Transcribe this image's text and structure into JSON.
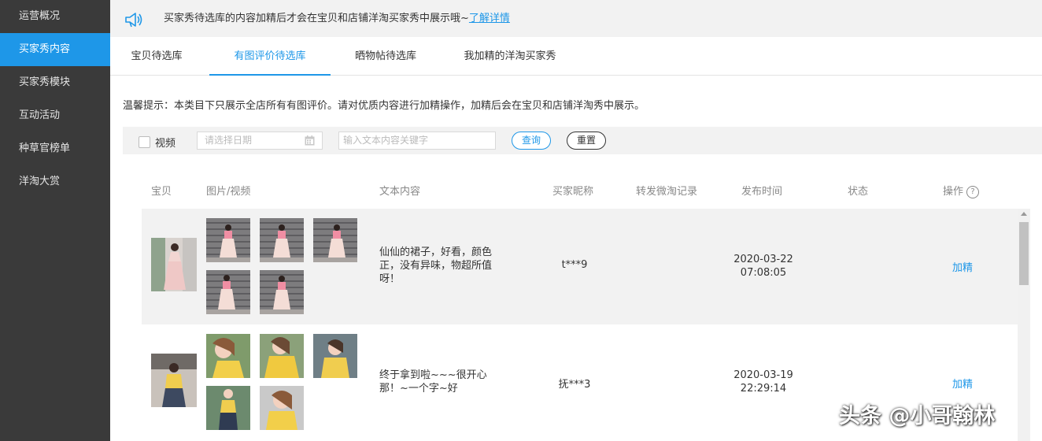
{
  "sidebar": {
    "items": [
      {
        "label": "运营概况"
      },
      {
        "label": "买家秀内容",
        "active": true
      },
      {
        "label": "买家秀模块"
      },
      {
        "label": "互动活动"
      },
      {
        "label": "种草官榜单"
      },
      {
        "label": "洋淘大赏"
      }
    ]
  },
  "notice": {
    "icon": "megaphone-icon",
    "text": "买家秀待选库的内容加精后才会在宝贝和店铺洋淘买家秀中展示哦~",
    "link": "了解详情"
  },
  "tabs": [
    {
      "label": "宝贝待选库"
    },
    {
      "label": "有图评价待选库",
      "active": true
    },
    {
      "label": "晒物帖待选库"
    },
    {
      "label": "我加精的洋淘买家秀"
    }
  ],
  "tip": "温馨提示：本类目下只展示全店所有有图评价。请对优质内容进行加精操作，加精后会在宝贝和店铺洋淘秀中展示。",
  "filter": {
    "video_label": "视频",
    "date_placeholder": "请选择日期",
    "keyword_placeholder": "输入文本内容关键字",
    "query_label": "查询",
    "reset_label": "重置"
  },
  "table": {
    "headers": {
      "product": "宝贝",
      "media": "图片/视频",
      "text": "文本内容",
      "nickname": "买家昵称",
      "repost": "转发微淘记录",
      "time": "发布时间",
      "status": "状态",
      "action": "操作"
    },
    "rows": [
      {
        "text": "仙仙的裙子，好看，颜色正，没有异味，物超所值呀！",
        "nickname": "t***9",
        "time": "2020-03-22 07:08:05",
        "action": "加精",
        "image_count": 5
      },
      {
        "text": "终于拿到啦~~~很开心那！~一个字~好",
        "nickname": "抚***3",
        "time": "2020-03-19 22:29:14",
        "action": "加精",
        "image_count": 5
      }
    ]
  },
  "watermark": "头条 @小哥翰林",
  "colors": {
    "accent": "#1e97e8",
    "sidebar_bg": "#3a3a3a",
    "row_highlight": "#f2f2f2"
  }
}
